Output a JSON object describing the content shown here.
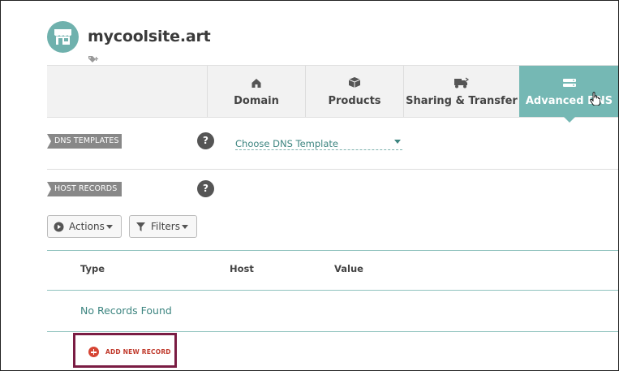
{
  "site": {
    "name": "mycoolsite.art"
  },
  "tabs": [
    {
      "label": "Domain",
      "icon": "home-icon"
    },
    {
      "label": "Products",
      "icon": "box-icon"
    },
    {
      "label": "Sharing & Transfer",
      "icon": "truck-icon"
    },
    {
      "label": "Advanced DNS",
      "icon": "server-icon",
      "active": true
    }
  ],
  "dns_templates": {
    "label": "DNS TEMPLATES",
    "help": "?",
    "select_value": "Choose DNS Template"
  },
  "host_records": {
    "label": "HOST RECORDS",
    "help": "?",
    "actions_label": "Actions",
    "filters_label": "Filters",
    "columns": [
      "Type",
      "Host",
      "Value"
    ],
    "empty_text": "No Records Found",
    "add_label": "ADD NEW RECORD"
  },
  "colors": {
    "accent": "#75b8b4",
    "add": "#d64534",
    "highlight": "#7a1c43"
  }
}
